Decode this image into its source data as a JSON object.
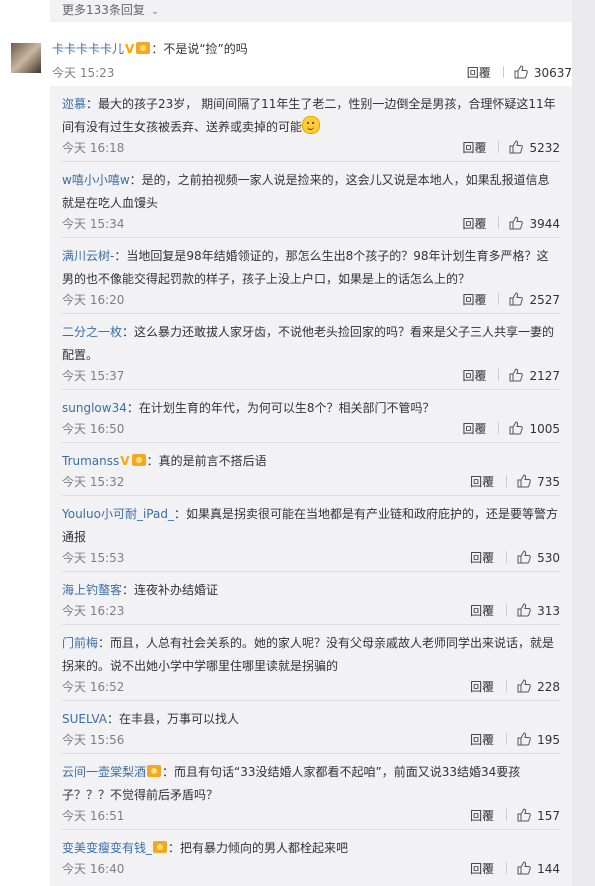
{
  "more_replies": {
    "label": "更多133条回复",
    "chevron": "chevron-down-icon"
  },
  "main_comment": {
    "username": "卡卡卡卡卡儿",
    "text": "：不是说“捡”的吗",
    "time": "今天 15:23",
    "reply_label": "回覆",
    "likes": "30637"
  },
  "replies": [
    {
      "user": "迩慕",
      "text": "：最大的孩子23岁， 期间间隔了11年生了老二，性别一边倒全是男孩，合理怀疑这11年间有没有过生女孩被丢弃、送养或卖掉的可能",
      "time": "今天 16:18",
      "reply_label": "回覆",
      "likes": "5232"
    },
    {
      "user": "w嘻小小嘻w",
      "text": "：是的，之前拍视频一家人说是捡来的，这会儿又说是本地人，如果乱报道信息就是在吃人血馒头",
      "time": "今天 15:34",
      "reply_label": "回覆",
      "likes": "3944"
    },
    {
      "user": "满川云树-",
      "text": "：当地回复是98年结婚领证的，那怎么生出8个孩子的？98年计划生育多严格？这男的也不像能交得起罚款的样子，孩子上没上户口，如果是上的话怎么上的？",
      "time": "今天 16:20",
      "reply_label": "回覆",
      "likes": "2527"
    },
    {
      "user": "二分之一枚",
      "text": "：这么暴力还敢拔人家牙齿，不说他老头捡回家的吗？看来是父子三人共享一妻的配置。",
      "time": "今天 15:37",
      "reply_label": "回覆",
      "likes": "2127"
    },
    {
      "user": "sunglow34",
      "text": "：在计划生育的年代，为何可以生8个？相关部门不管吗？",
      "time": "今天 16:50",
      "reply_label": "回覆",
      "likes": "1005"
    },
    {
      "user": "Trumanss",
      "text": "：真的是前言不搭后语",
      "time": "今天 15:32",
      "reply_label": "回覆",
      "likes": "735"
    },
    {
      "user": "Youluo小可耐_iPad_",
      "text": "：如果真是拐卖很可能在当地都是有产业链和政府庇护的，还是要等警方通报",
      "time": "今天 15:53",
      "reply_label": "回覆",
      "likes": "530"
    },
    {
      "user": "海上钓螯客",
      "text": "：连夜补办结婚证",
      "time": "今天 16:23",
      "reply_label": "回覆",
      "likes": "313"
    },
    {
      "user": "门前梅",
      "text": "：而且，人总有社会关系的。她的家人呢？没有父母亲戚故人老师同学出来说话，就是拐来的。说不出她小学中学哪里住哪里读就是拐骗的",
      "time": "今天 16:52",
      "reply_label": "回覆",
      "likes": "228"
    },
    {
      "user": "SUELVA",
      "text": "：在丰县，万事可以找人",
      "time": "今天 15:56",
      "reply_label": "回覆",
      "likes": "195"
    },
    {
      "user": "云间一壶棠梨酒",
      "text": "：而且有句话“33没结婚人家都看不起咱”，前面又说33结婚34要孩子？？？不觉得前后矛盾吗？",
      "time": "今天 16:51",
      "reply_label": "回覆",
      "likes": "157"
    },
    {
      "user": "变美变瘦变有钱_",
      "text": "：把有暴力倾向的男人都栓起来吧",
      "time": "今天 16:40",
      "reply_label": "回覆",
      "likes": "144"
    }
  ]
}
